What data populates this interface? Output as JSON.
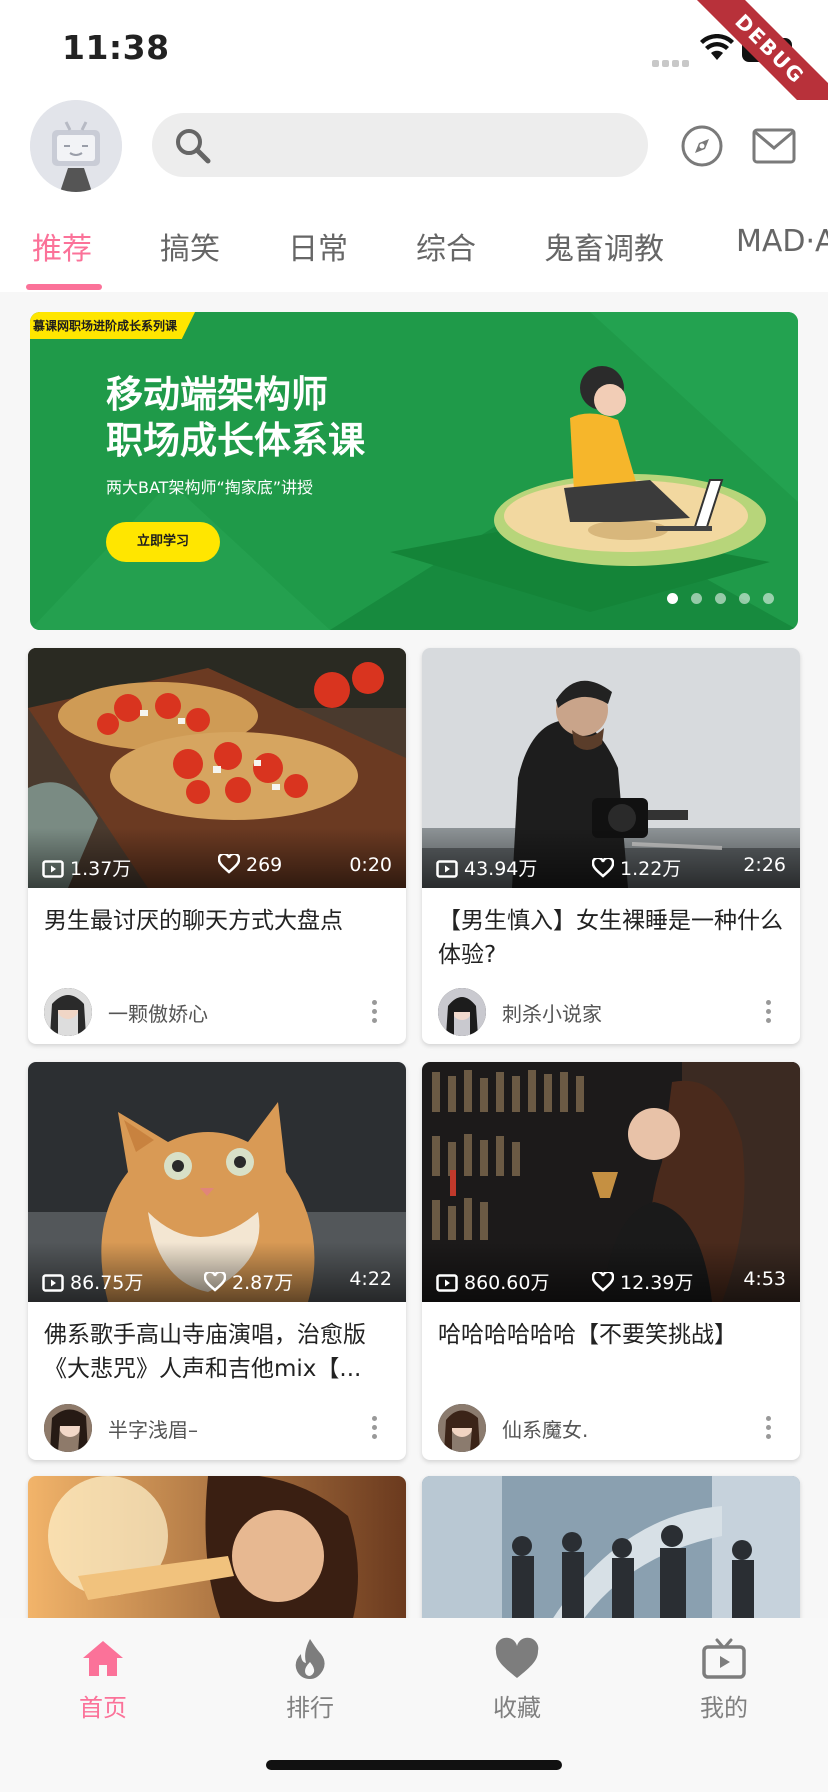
{
  "status_bar": {
    "time": "11:38",
    "debug_label": "DEBUG"
  },
  "header": {
    "search": {
      "placeholder": ""
    }
  },
  "tabs": [
    {
      "label": "推荐",
      "active": true
    },
    {
      "label": "搞笑"
    },
    {
      "label": "日常"
    },
    {
      "label": "综合"
    },
    {
      "label": "鬼畜调教"
    },
    {
      "label": "MAD·AMV"
    }
  ],
  "banner": {
    "tag": "慕课网职场进阶成长系列课",
    "title_line1": "移动端架构师",
    "title_line2": "职场成长体系课",
    "subtitle": "两大BAT架构师“掏家底”讲授",
    "button_label": "立即学习",
    "dots": 5,
    "active_dot": 1
  },
  "videos": [
    {
      "plays": "1.37万",
      "likes": "269",
      "duration": "0:20",
      "title": "男生最讨厌的聊天方式大盘点",
      "owner": "一颗傲娇心"
    },
    {
      "plays": "43.94万",
      "likes": "1.22万",
      "duration": "2:26",
      "title": "【男生慎入】女生裸睡是一种什么体验?",
      "owner": "刺杀小说家"
    },
    {
      "plays": "86.75万",
      "likes": "2.87万",
      "duration": "4:22",
      "title": "佛系歌手高山寺庙演唱，治愈版《大悲咒》人声和吉他mix【...",
      "owner": "半字浅眉–"
    },
    {
      "plays": "860.60万",
      "likes": "12.39万",
      "duration": "4:53",
      "title": "哈哈哈哈哈哈【不要笑挑战】",
      "owner": "仙系魔女."
    }
  ],
  "bottom_nav": [
    {
      "label": "首页",
      "icon": "home-icon",
      "active": true
    },
    {
      "label": "排行",
      "icon": "fire-icon"
    },
    {
      "label": "收藏",
      "icon": "heart-icon"
    },
    {
      "label": "我的",
      "icon": "tv-icon"
    }
  ],
  "colors": {
    "accent": "#fb7299",
    "banner_green": "#1f9a49",
    "banner_yellow": "#ffe600"
  }
}
